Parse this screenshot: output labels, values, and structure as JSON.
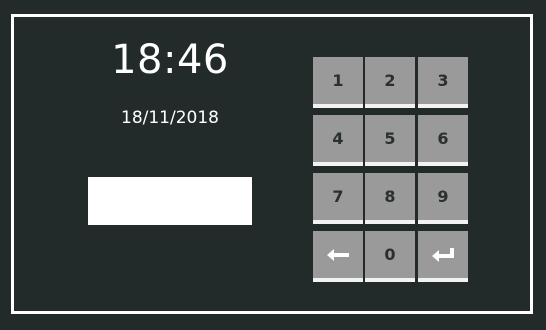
{
  "clock": {
    "time": "18:46",
    "date": "18/11/2018"
  },
  "pin_input": {
    "value": ""
  },
  "keypad": {
    "keys": [
      {
        "label": "1",
        "name": "key-1"
      },
      {
        "label": "2",
        "name": "key-2"
      },
      {
        "label": "3",
        "name": "key-3"
      },
      {
        "label": "4",
        "name": "key-4"
      },
      {
        "label": "5",
        "name": "key-5"
      },
      {
        "label": "6",
        "name": "key-6"
      },
      {
        "label": "7",
        "name": "key-7"
      },
      {
        "label": "8",
        "name": "key-8"
      },
      {
        "label": "9",
        "name": "key-9"
      },
      {
        "label": "",
        "name": "backspace-key",
        "icon": "arrow-left-icon"
      },
      {
        "label": "0",
        "name": "key-0"
      },
      {
        "label": "",
        "name": "enter-key",
        "icon": "enter-icon"
      }
    ]
  },
  "colors": {
    "background": "#232b2a",
    "frame": "#ffffff",
    "key": "#9a9a9a",
    "key_underline": "#f2f2f2"
  }
}
